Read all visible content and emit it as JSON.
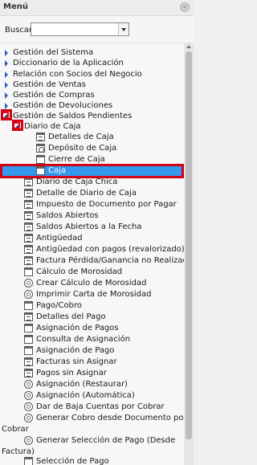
{
  "header": {
    "title": "Menú",
    "close_glyph": "«"
  },
  "search": {
    "label": "Buscar:",
    "value": "",
    "placeholder": ""
  },
  "tree": {
    "top_items": [
      "Gestión del Sistema",
      "Diccionario de la Aplicación",
      "Relación con Socios del Negocio",
      "Gestión de Ventas",
      "Gestión de Compras",
      "Gestión de Devoluciones"
    ],
    "open_group": "Gestión de Saldos Pendientes",
    "sub_group": "Diario de Caja",
    "sub_items": [
      "Detalles de Caja",
      "Depósito de Caja",
      "Cierre de Caja",
      "Caja"
    ],
    "items": [
      "Diario de Caja Chica",
      "Detalle de Diario de Caja",
      "Impuesto de Documento por Pagar",
      "Saldos Abiertos",
      "Saldos Abiertos a la Fecha",
      "Antigüedad",
      "Antigüedad con pagos (revalorizado)",
      "Factura Pérdida/Ganancia no Realizada",
      "Cálculo de Morosidad",
      "Crear Cálculo de Morosidad",
      "Imprimir Carta de Morosidad",
      "Pago/Cobro",
      "Detalles del Pago",
      "Asignación de Pagos",
      "Consulta de Asignación",
      "Asignación de Pago",
      "Facturas sin Asignar",
      "Pagos sin Asignar",
      "Asignación (Restaurar)",
      "Asignación (Automática)",
      "Dar de Baja Cuentas por Cobrar"
    ],
    "wrap_item_1": [
      "Generar Cobro desde Documento por",
      "Cobrar"
    ],
    "wrap_item_2": [
      "Generar Selección de Pago (Desde",
      "Factura)"
    ],
    "last_item": "Selección de Pago"
  },
  "colors": {
    "selected_bg": "#3399ee",
    "highlight": "#d10014",
    "arrow": "#2d5fb8"
  }
}
